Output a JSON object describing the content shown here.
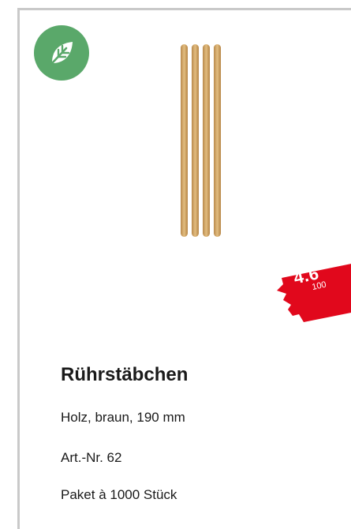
{
  "badge": {
    "icon": "leaf-icon",
    "color": "#5aa86a"
  },
  "product": {
    "image_icon": "wooden-stirrers-image",
    "title": "Rührstäbchen",
    "description": "Holz, braun, 190 mm",
    "article_number": "Art.-Nr. 62",
    "package": "Paket à 1000 Stück"
  },
  "price_tag": {
    "price": "4.6",
    "quantity": "100",
    "color": "#e1081c"
  }
}
